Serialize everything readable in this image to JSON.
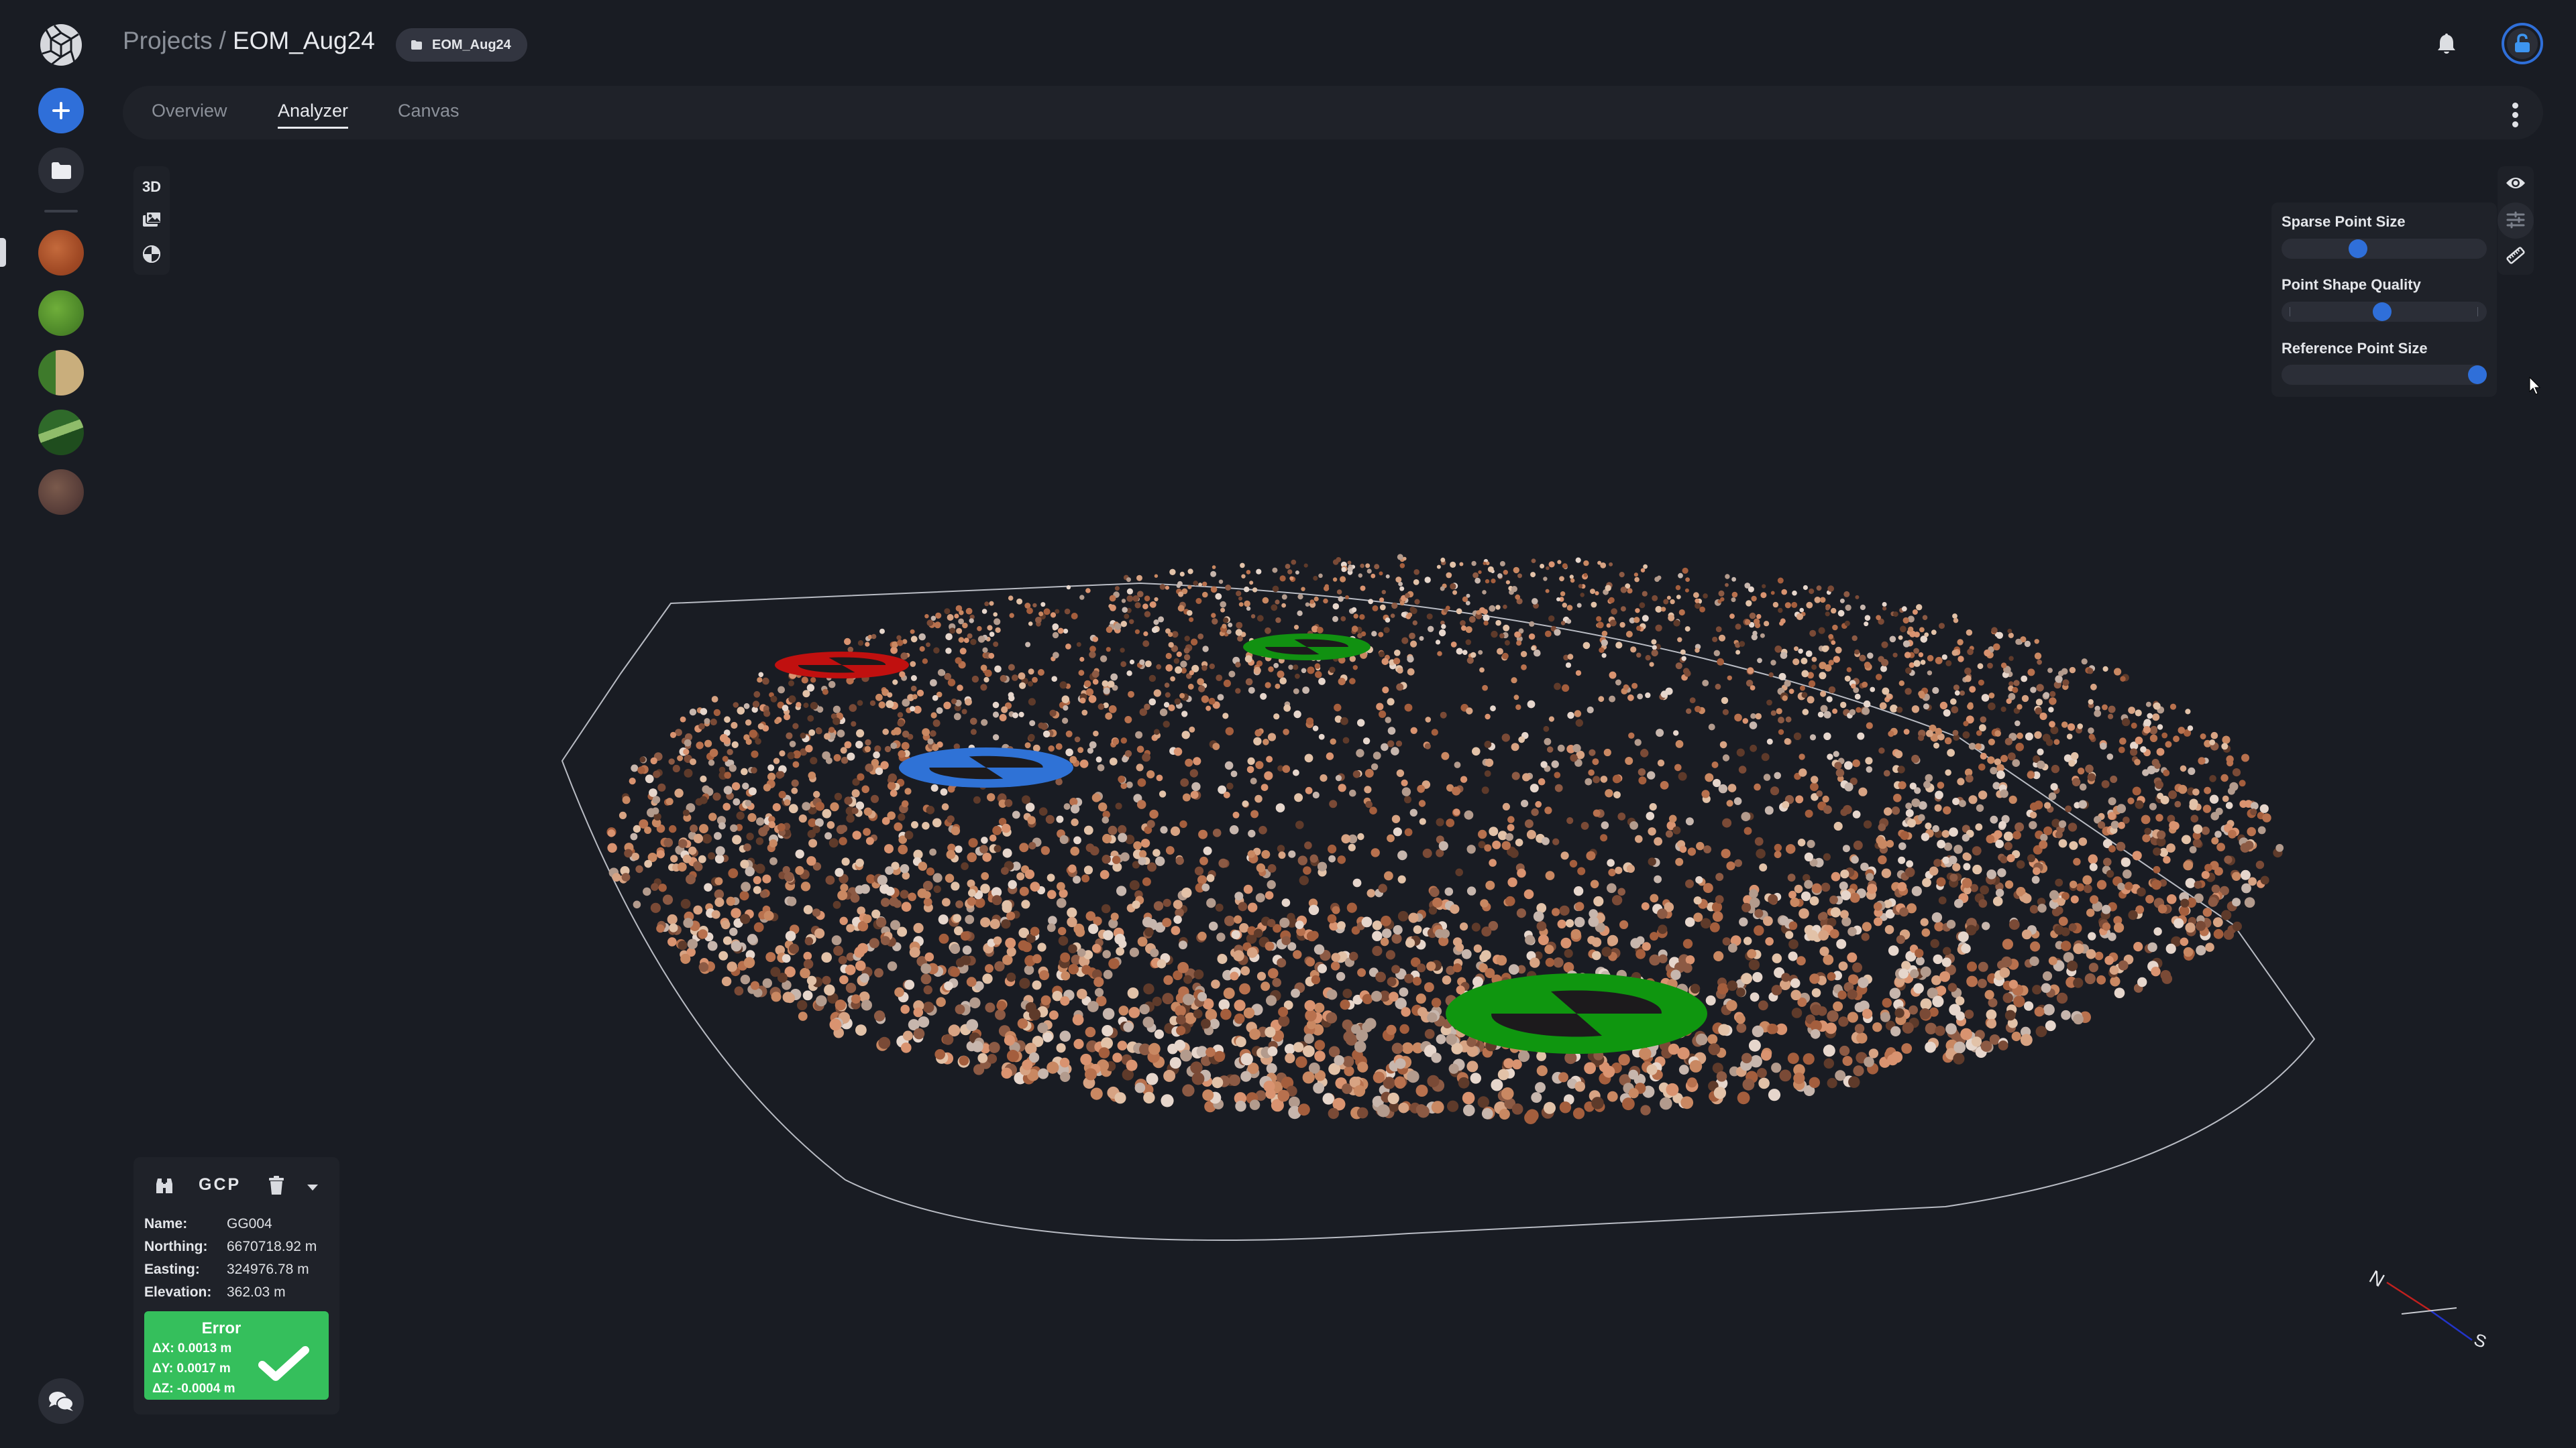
{
  "header": {
    "breadcrumb_root": "Projects",
    "breadcrumb_separator": "/",
    "breadcrumb_current": "EOM_Aug24",
    "chip_label": "EOM_Aug24",
    "chip_icon": "folder-icon",
    "notification_icon": "bell-icon",
    "account_icon": "unlock-icon"
  },
  "sidebar": {
    "logo_icon": "aperture-cube-logo",
    "new_button_icon": "plus-icon",
    "projects_button_icon": "folder-icon",
    "thumbnails": [
      {
        "name": "project-thumb-1",
        "colors": [
          "#a14a25",
          "#c46a3c",
          "#8a3b1d"
        ]
      },
      {
        "name": "project-thumb-2",
        "colors": [
          "#4f8a2a",
          "#6fae3a",
          "#3b6c22"
        ]
      },
      {
        "name": "project-thumb-3",
        "colors": [
          "#3e7a2b",
          "#c9ae7c",
          "#e4cc8a"
        ]
      },
      {
        "name": "project-thumb-4",
        "colors": [
          "#2f6a2a",
          "#8fbc6a",
          "#1f4d1e"
        ]
      },
      {
        "name": "project-thumb-5",
        "colors": [
          "#5a3f3a",
          "#7a5a4c",
          "#3f2c2a"
        ]
      }
    ],
    "chat_icon": "chat-bubbles-icon"
  },
  "tabs": [
    {
      "label": "Overview",
      "active": false
    },
    {
      "label": "Analyzer",
      "active": true
    },
    {
      "label": "Canvas",
      "active": false
    }
  ],
  "tabbar_menu_icon": "kebab-menu-icon",
  "viewer_toolbar": {
    "mode_label": "3D",
    "items": [
      "3d-mode",
      "images-icon",
      "globe-quadrant-icon"
    ]
  },
  "right_rail": {
    "items": [
      "eye-icon",
      "sliders-icon",
      "ruler-icon"
    ],
    "active": "sliders-icon"
  },
  "settings": {
    "sliders": [
      {
        "label": "Sparse Point Size",
        "value": 0.36
      },
      {
        "label": "Point Shape Quality",
        "value": 0.49,
        "ticks": true
      },
      {
        "label": "Reference Point Size",
        "value": 1.0
      }
    ]
  },
  "gcp_panel": {
    "title": "GCP",
    "fields": [
      {
        "key": "Name:",
        "value": "GG004"
      },
      {
        "key": "Northing:",
        "value": "6670718.92 m"
      },
      {
        "key": "Easting:",
        "value": "324976.78 m"
      },
      {
        "key": "Elevation:",
        "value": "362.03 m"
      }
    ],
    "error": {
      "title": "Error",
      "dx": "ΔX: 0.0013 m",
      "dy": "ΔY: 0.0017 m",
      "dz": "ΔZ: -0.0004 m",
      "status": "ok"
    }
  },
  "compass": {
    "north_label": "N",
    "south_label": "S"
  },
  "markers": [
    {
      "name": "gcp-marker-red",
      "color": "#c0100f"
    },
    {
      "name": "gcp-marker-green-top",
      "color": "#119111"
    },
    {
      "name": "gcp-marker-blue",
      "color": "#2f72d6"
    },
    {
      "name": "gcp-marker-green-selected",
      "color": "#0f960f"
    }
  ],
  "colors": {
    "accent": "#2f6fd9",
    "background": "#191c23",
    "panel": "#1f2229",
    "success": "#35bf5c"
  }
}
